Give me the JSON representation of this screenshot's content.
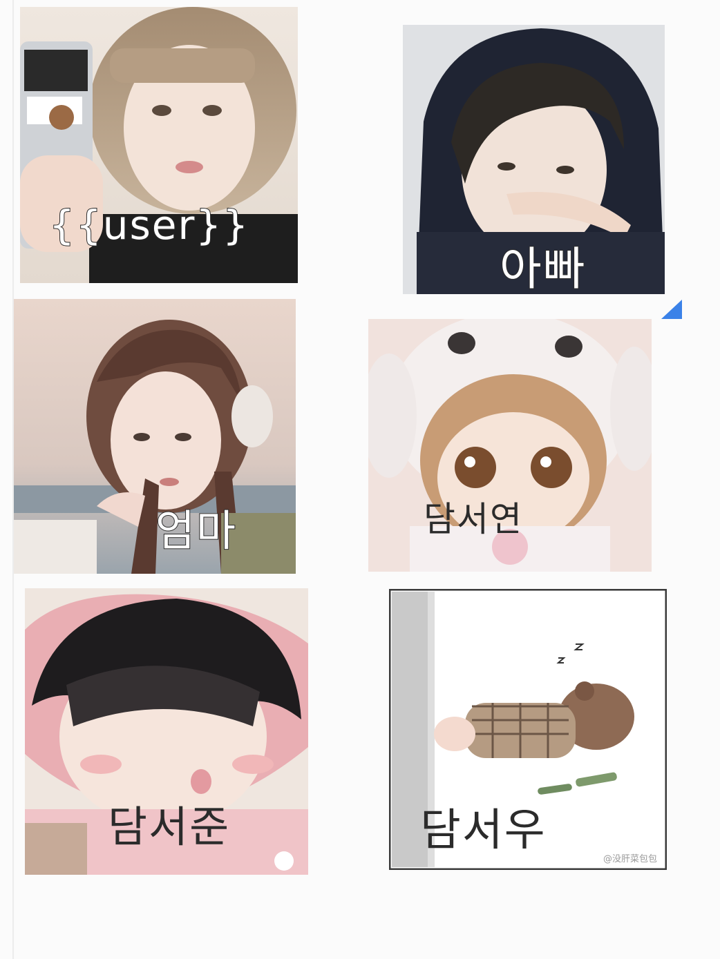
{
  "cards": [
    {
      "caption": "{{user}}"
    },
    {
      "caption": "아빠"
    },
    {
      "caption": "엄마"
    },
    {
      "caption": "담서연"
    },
    {
      "caption": "담서준"
    },
    {
      "caption": "담서우"
    }
  ],
  "watermark": "@没肝菜包包",
  "colors": {
    "caption_fill": "#ffffff",
    "caption_stroke": "#2b2b2b",
    "corner_mark": "#3b82e8"
  }
}
